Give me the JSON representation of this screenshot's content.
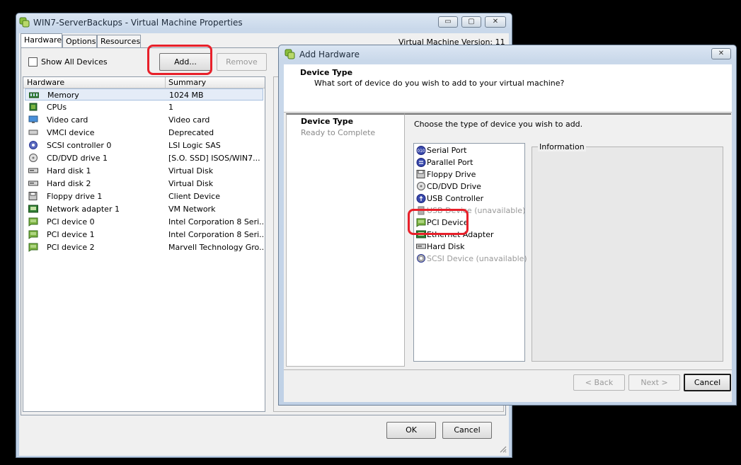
{
  "main_window": {
    "title": "WIN7-ServerBackups - Virtual Machine Properties",
    "tabs": [
      "Hardware",
      "Options",
      "Resources"
    ],
    "version_text": "Virtual Machine Version: 11",
    "show_all_devices_label": "Show All Devices",
    "add_label": "Add...",
    "remove_label": "Remove",
    "table_headers": {
      "hardware": "Hardware",
      "summary": "Summary"
    },
    "hardware": [
      {
        "name": "Memory",
        "summary": "1024 MB",
        "icon": "memory-icon"
      },
      {
        "name": "CPUs",
        "summary": "1",
        "icon": "cpu-icon"
      },
      {
        "name": "Video card",
        "summary": "Video card",
        "icon": "monitor-icon"
      },
      {
        "name": "VMCI device",
        "summary": "Deprecated",
        "icon": "vmci-icon"
      },
      {
        "name": "SCSI controller 0",
        "summary": "LSI Logic SAS",
        "icon": "scsi-icon"
      },
      {
        "name": "CD/DVD drive 1",
        "summary": "[S.O. SSD] ISOS/WIN7...",
        "icon": "cdrom-icon"
      },
      {
        "name": "Hard disk 1",
        "summary": "Virtual Disk",
        "icon": "disk-icon"
      },
      {
        "name": "Hard disk 2",
        "summary": "Virtual Disk",
        "icon": "disk-icon"
      },
      {
        "name": "Floppy drive 1",
        "summary": "Client Device",
        "icon": "floppy-icon"
      },
      {
        "name": "Network adapter 1",
        "summary": "VM Network",
        "icon": "network-icon"
      },
      {
        "name": "PCI device 0",
        "summary": "Intel Corporation 8 Seri...",
        "icon": "pci-icon"
      },
      {
        "name": "PCI device 1",
        "summary": "Intel Corporation 8 Seri...",
        "icon": "pci-icon"
      },
      {
        "name": "PCI device 2",
        "summary": "Marvell Technology Gro...",
        "icon": "pci-icon"
      }
    ],
    "ok_label": "OK",
    "cancel_label": "Cancel"
  },
  "dialog": {
    "title": "Add Hardware",
    "header_title": "Device Type",
    "header_subtitle": "What sort of device do you wish to add to your virtual machine?",
    "steps": [
      "Device Type",
      "Ready to Complete"
    ],
    "prompt": "Choose the type of device you wish to add.",
    "information_label": "Information",
    "devices": [
      {
        "label": "Serial Port",
        "available": true,
        "icon": "serial-port-icon"
      },
      {
        "label": "Parallel Port",
        "available": true,
        "icon": "parallel-port-icon"
      },
      {
        "label": "Floppy Drive",
        "available": true,
        "icon": "floppy-icon"
      },
      {
        "label": "CD/DVD Drive",
        "available": true,
        "icon": "cdrom-icon"
      },
      {
        "label": "USB Controller",
        "available": true,
        "icon": "usb-icon"
      },
      {
        "label": "USB Device (unavailable)",
        "available": false,
        "icon": "usb-device-icon"
      },
      {
        "label": "PCI Device",
        "available": true,
        "icon": "pci-icon"
      },
      {
        "label": "Ethernet Adapter",
        "available": true,
        "icon": "network-icon"
      },
      {
        "label": "Hard Disk",
        "available": true,
        "icon": "disk-icon"
      },
      {
        "label": "SCSI Device (unavailable)",
        "available": false,
        "icon": "scsi-icon"
      }
    ],
    "back_label": "< Back",
    "next_label": "Next >",
    "cancel_label": "Cancel",
    "close_glyph": "✕"
  },
  "titlebar_glyphs": {
    "minimize": "▭",
    "maximize": "▢",
    "close": "✕"
  }
}
